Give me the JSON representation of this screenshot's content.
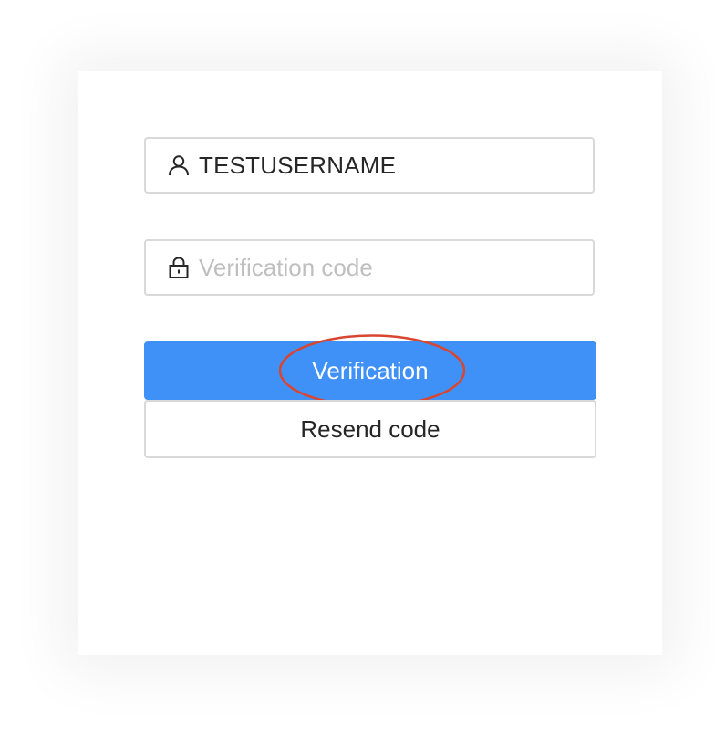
{
  "login": {
    "username_value": "TESTUSERNAME",
    "code_placeholder": "Verification code",
    "verify_label": "Verification",
    "resend_label": "Resend code"
  },
  "icons": {
    "username": "user-icon",
    "code": "lock-icon"
  },
  "colors": {
    "primary": "#4091f7",
    "annotation": "#d9452f",
    "border": "#d9d9d9",
    "placeholder": "#bfbfbf"
  }
}
